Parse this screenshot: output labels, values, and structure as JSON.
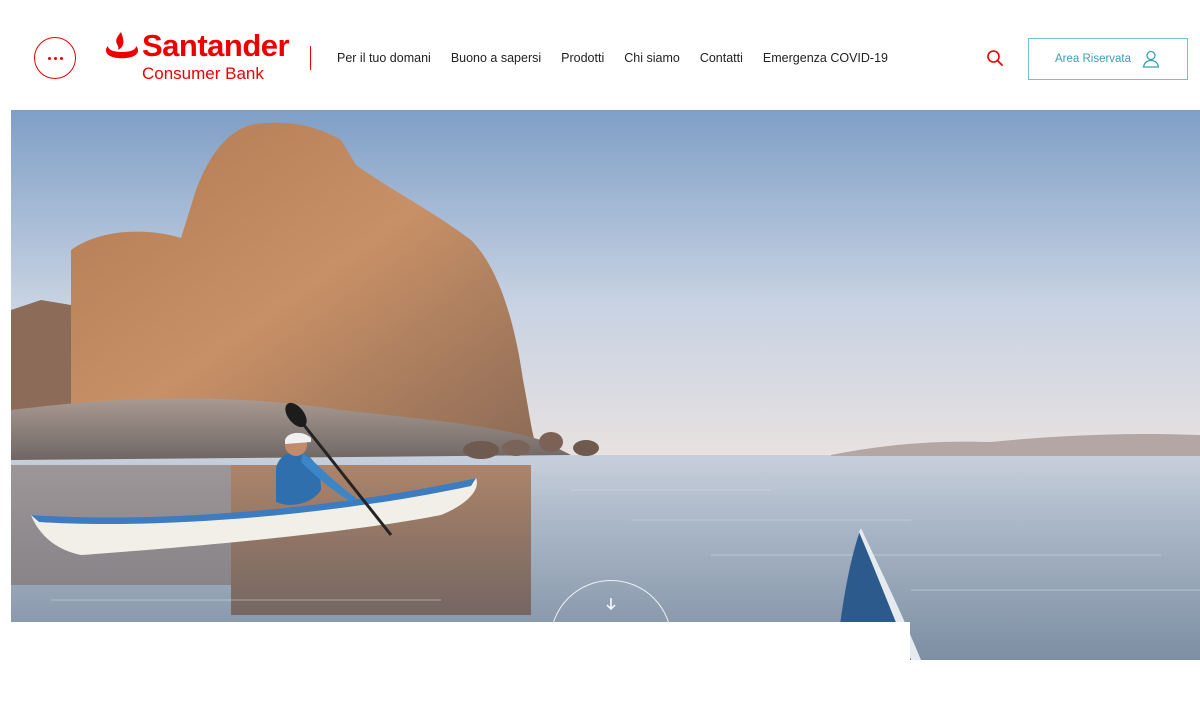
{
  "header": {
    "menu_icon": "more-dots-icon",
    "logo": {
      "name": "Santander",
      "subtitle": "Consumer Bank",
      "color": "#ec0000"
    },
    "nav": [
      {
        "label": "Per il tuo domani"
      },
      {
        "label": "Buono a sapersi"
      },
      {
        "label": "Prodotti"
      },
      {
        "label": "Chi siamo"
      },
      {
        "label": "Contatti"
      },
      {
        "label": "Emergenza COVID-19"
      }
    ],
    "search_icon": "search-icon",
    "area_riservata": {
      "label": "Area Riservata",
      "icon": "user-icon"
    }
  },
  "hero": {
    "image": "kayaker-near-rock-at-sea",
    "scroll_icon": "arrow-down-icon"
  },
  "colors": {
    "brand_red": "#ec0000",
    "accent_teal": "#3a9eb6",
    "border_teal": "#6ec4d6"
  }
}
